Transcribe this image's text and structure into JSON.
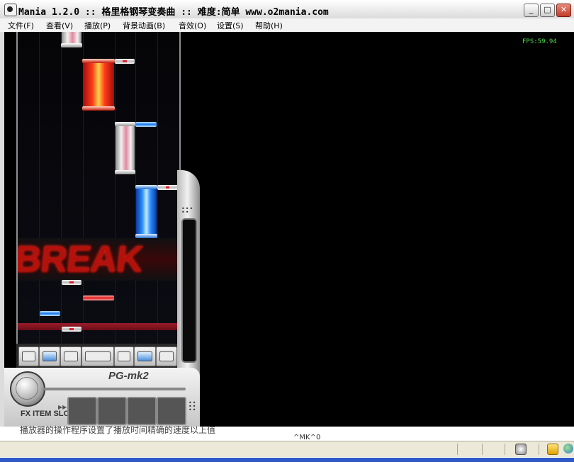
{
  "window": {
    "title": "Mania 1.2.0 :: 格里格钢琴变奏曲 :: 难度:简单 www.o2mania.com",
    "minimize_glyph": "_",
    "maximize_glyph": "□",
    "close_glyph": "✕"
  },
  "menu": [
    {
      "label": "文件(F)"
    },
    {
      "label": "查看(V)"
    },
    {
      "label": "播放(P)"
    },
    {
      "label": "背景动画(B)"
    },
    {
      "label": "音效(O)"
    },
    {
      "label": "设置(S)"
    },
    {
      "label": "帮助(H)"
    }
  ],
  "game": {
    "fps": "FPS:59.94",
    "judgement": "BREAK",
    "device_label": "PG-mk2",
    "fx_slot_label": "FX ITEM SLOT",
    "fx_arrows": "▶▶",
    "lanes": 7,
    "active_keys": [
      2,
      6
    ],
    "colors": {
      "white_note": "#e6e6e6",
      "blue_note": "#1a78f0",
      "red_note": "#e01818",
      "judge_line": "#9c1c2b",
      "fps_text": "#4cdc4c"
    }
  },
  "background_window": {
    "text_line": "播放器的操作程序设置了播放时间精确的速度以上值",
    "item": "^MK^0"
  },
  "icons": [
    "app-icon",
    "volume-knob-icon",
    "network-tray-icon",
    "warning-tray-icon",
    "globe-tray-icon"
  ]
}
